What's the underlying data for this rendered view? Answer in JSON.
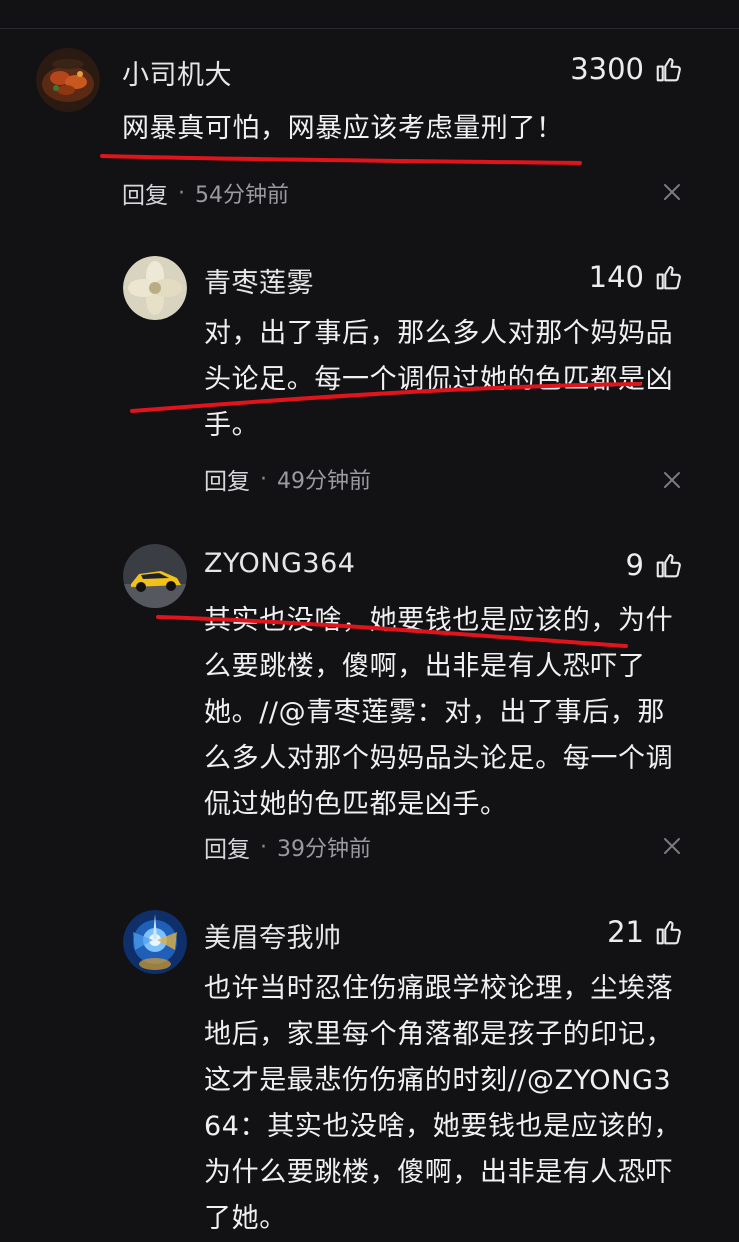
{
  "comments": [
    {
      "username": "小司机大",
      "likes": "3300",
      "lines": [
        "网暴真可怕，网暴应该考虑量刑了！"
      ],
      "reply_label": "回复",
      "time": "54分钟前"
    },
    {
      "username": "青枣莲雾",
      "likes": "140",
      "lines": [
        "对，出了事后，那么多人对那个妈妈品",
        "头论足。每一个调侃过她的色匹都是凶",
        "手。"
      ],
      "reply_label": "回复",
      "time": "49分钟前"
    },
    {
      "username": "ZYONG364",
      "likes": "9",
      "lines": [
        "其实也没啥，她要钱也是应该的，为什",
        "么要跳楼，傻啊，出非是有人恐吓了",
        "她。//@青枣莲雾：对，出了事后，那",
        "么多人对那个妈妈品头论足。每一个调",
        "侃过她的色匹都是凶手。"
      ],
      "reply_label": "回复",
      "time": "39分钟前"
    },
    {
      "username": "美眉夸我帅",
      "likes": "21",
      "lines": [
        "也许当时忍住伤痛跟学校论理，尘埃落",
        "地后，家里每个角落都是孩子的印记，",
        "这才是最悲伤伤痛的时刻//@ZYONG3",
        "64：其实也没啥，她要钱也是应该的，",
        "为什么要跳楼，傻啊，出非是有人恐吓",
        "了她。"
      ]
    }
  ],
  "icons": {
    "like": "thumbs-up-icon",
    "close": "close-icon"
  },
  "colors": {
    "background": "#121214",
    "annotation": "#e0141c",
    "meta_text": "#9a9aa0"
  }
}
